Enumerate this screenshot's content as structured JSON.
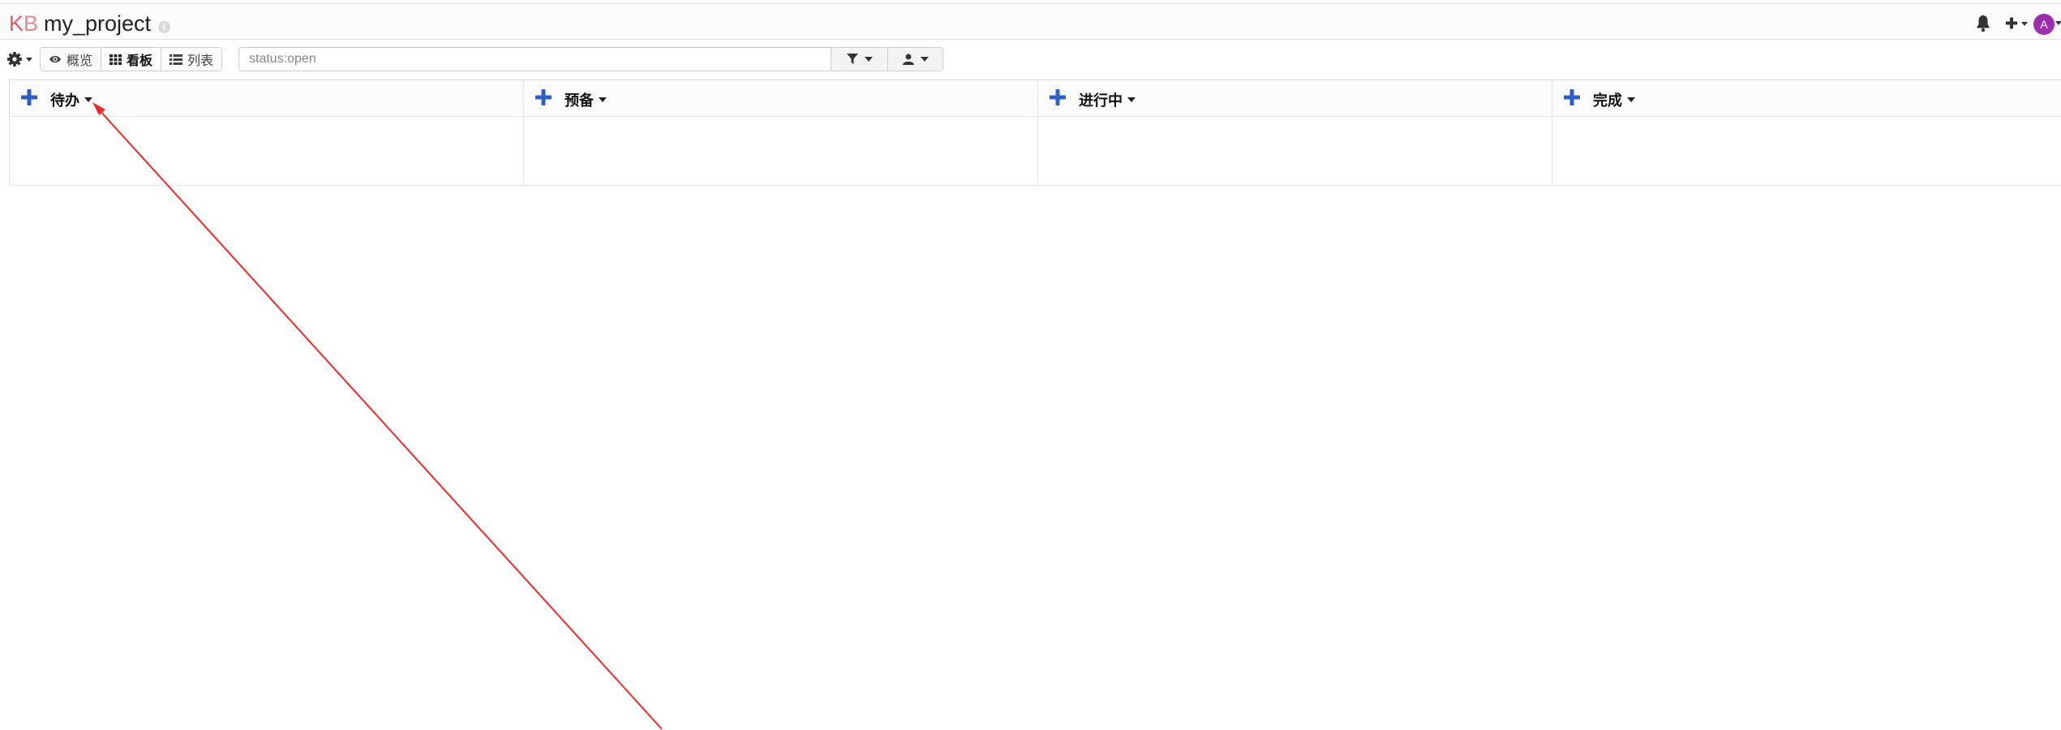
{
  "header": {
    "logo_k": "K",
    "logo_b": "B",
    "project_name": "my_project",
    "info_icon": "info-icon",
    "avatar_letter": "A",
    "icons": [
      "bell-icon",
      "plus-icon",
      "caret-down-icon"
    ]
  },
  "toolbar": {
    "settings_icon": "gear-icon",
    "views": [
      {
        "label": "概览",
        "icon": "eye-icon",
        "active": false
      },
      {
        "label": "看板",
        "icon": "grid-icon",
        "active": true
      },
      {
        "label": "列表",
        "icon": "list-icon",
        "active": false
      }
    ],
    "search": {
      "value": "",
      "placeholder": "status:open"
    },
    "filter_icon": "filter-icon",
    "user_filter_icon": "user-icon"
  },
  "board": {
    "columns": [
      {
        "title": "待办"
      },
      {
        "title": "预备"
      },
      {
        "title": "进行中"
      },
      {
        "title": "完成"
      }
    ]
  },
  "colors": {
    "logo_k": "#e45e5e",
    "accent_blue": "#2e5fc4",
    "avatar": "#9b2fae",
    "annotation_arrow": "#ee2a2a"
  }
}
